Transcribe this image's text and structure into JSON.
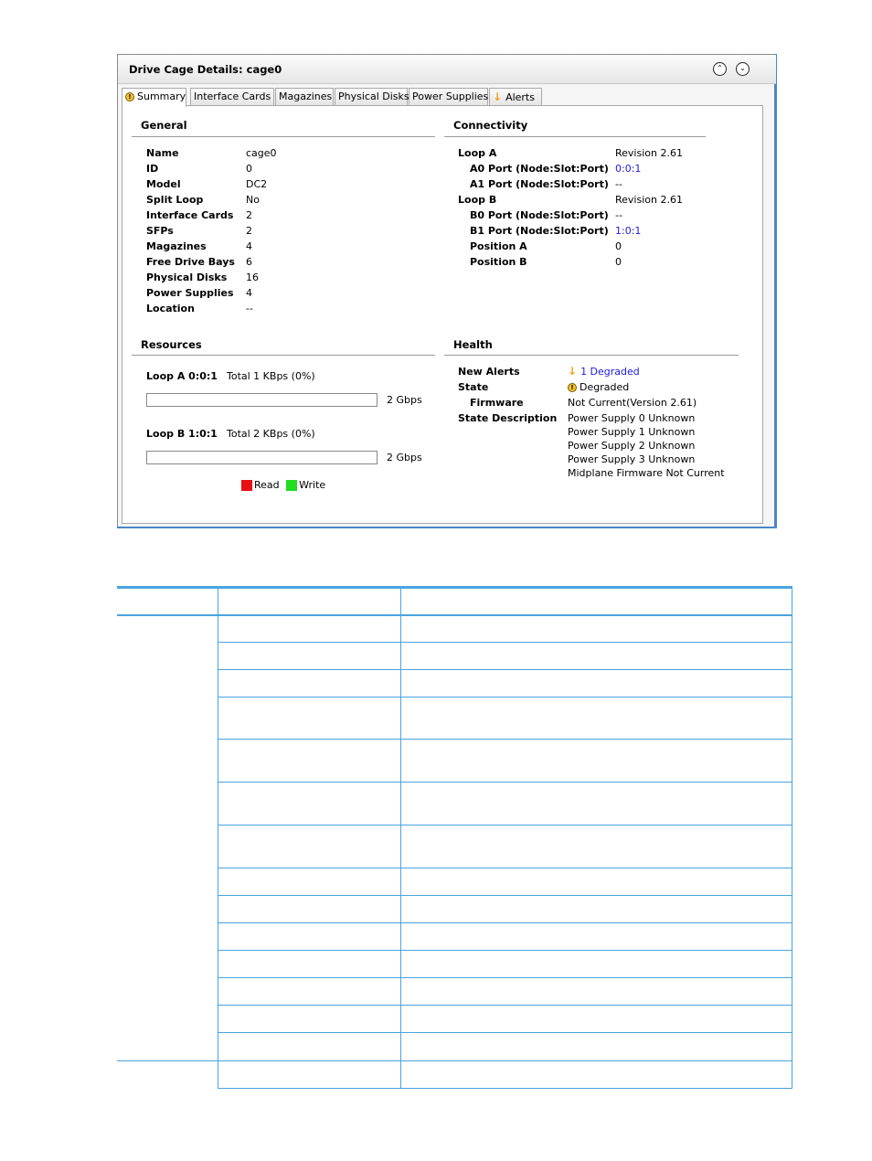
{
  "panel": {
    "title": "Drive Cage Details: cage0",
    "collapse_icon": "double-chevron-up-icon",
    "expand_icon": "double-chevron-down-icon"
  },
  "tabs": [
    {
      "label": "Summary",
      "icon": "warning-circle-icon",
      "active": true
    },
    {
      "label": "Interface Cards"
    },
    {
      "label": "Magazines"
    },
    {
      "label": "Physical Disks"
    },
    {
      "label": "Power Supplies"
    },
    {
      "label": "Alerts",
      "icon": "down-arrow-alert-icon"
    }
  ],
  "general": {
    "heading": "General",
    "rows": [
      {
        "label": "Name",
        "value": "cage0"
      },
      {
        "label": "ID",
        "value": "0"
      },
      {
        "label": "Model",
        "value": "DC2"
      },
      {
        "label": "Split Loop",
        "value": "No"
      },
      {
        "label": "Interface Cards",
        "value": "2"
      },
      {
        "label": "SFPs",
        "value": "2"
      },
      {
        "label": "Magazines",
        "value": "4"
      },
      {
        "label": "Free Drive Bays",
        "value": "6"
      },
      {
        "label": "Physical Disks",
        "value": "16"
      },
      {
        "label": "Power Supplies",
        "value": "4"
      },
      {
        "label": "Location",
        "value": "--"
      }
    ]
  },
  "connectivity": {
    "heading": "Connectivity",
    "rows": [
      {
        "label": "Loop A",
        "value": "Revision 2.61"
      },
      {
        "label": "A0 Port (Node:Slot:Port)",
        "value": "0:0:1"
      },
      {
        "label": "A1 Port (Node:Slot:Port)",
        "value": "--"
      },
      {
        "label": "Loop B",
        "value": "Revision 2.61"
      },
      {
        "label": "B0 Port (Node:Slot:Port)",
        "value": "--"
      },
      {
        "label": "B1 Port (Node:Slot:Port)",
        "value": "1:0:1"
      },
      {
        "label": "Position A",
        "value": "0"
      },
      {
        "label": "Position B",
        "value": "0"
      }
    ]
  },
  "resources": {
    "heading": "Resources",
    "loops": [
      {
        "label": "Loop A 0:0:1",
        "total": "Total 1 KBps (0%)",
        "capacity": "2 Gbps",
        "read_fraction": 0,
        "write_fraction": 0
      },
      {
        "label": "Loop B 1:0:1",
        "total": "Total 2 KBps (0%)",
        "capacity": "2 Gbps",
        "read_fraction": 0,
        "write_fraction": 0
      }
    ],
    "legend": {
      "read": "Read",
      "write": "Write",
      "read_color": "#e81010",
      "write_color": "#22dd22"
    }
  },
  "health": {
    "heading": "Health",
    "new_alerts_label": "New Alerts",
    "new_alerts_value": "1 Degraded",
    "state_label": "State",
    "state_value": "Degraded",
    "firmware_label": "Firmware",
    "firmware_value": "Not Current(Version 2.61)",
    "state_desc_label": "State Description",
    "state_desc_lines": [
      "Power Supply 0 Unknown",
      "Power Supply 1 Unknown",
      "Power Supply 2 Unknown",
      "Power Supply 3 Unknown",
      "Midplane Firmware Not Current"
    ]
  },
  "colors": {
    "accent_blue": "#4a87c8",
    "link_blue": "#1a1ae6",
    "table_rule": "#4aa3df"
  },
  "table": {
    "header_cells": [
      "",
      "",
      ""
    ],
    "body_rows": 16
  }
}
